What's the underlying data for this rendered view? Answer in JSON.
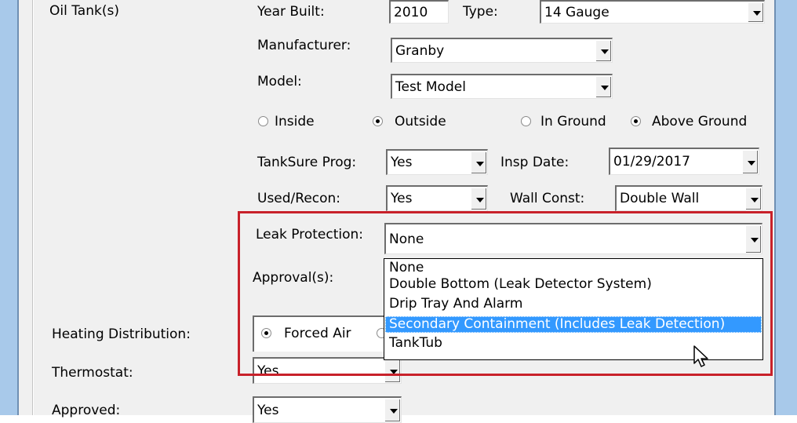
{
  "labels": {
    "oil_tanks": "Oil Tank(s)",
    "year_built": "Year Built:",
    "type": "Type:",
    "manufacturer": "Manufacturer:",
    "model": "Model:",
    "tanksure": "TankSure Prog:",
    "insp_date": "Insp Date:",
    "used_recon": "Used/Recon:",
    "wall_const": "Wall Const:",
    "leak_protection": "Leak Protection:",
    "approvals": "Approval(s):",
    "heating_distribution": "Heating Distribution:",
    "thermostat": "Thermostat:",
    "approved": "Approved:"
  },
  "values": {
    "year_built": "2010",
    "type": "14 Gauge",
    "manufacturer": "Granby",
    "model": "Test Model",
    "tanksure": "Yes",
    "insp_date": "01/29/2017",
    "used_recon": "Yes",
    "wall_const": "Double Wall",
    "leak_protection": "None",
    "thermostat": "Yes",
    "approved": "Yes"
  },
  "radios": {
    "inside": "Inside",
    "outside": "Outside",
    "in_ground": "In Ground",
    "above_ground": "Above Ground",
    "forced_air": "Forced Air"
  },
  "leak_protection_options": [
    "None",
    "Double Bottom (Leak Detector System)",
    "Drip Tray And Alarm",
    "Secondary Containment (Includes Leak Detection)",
    "TankTub"
  ],
  "selected_option_index": 3,
  "colors": {
    "highlight_border": "#c8212a",
    "selection": "#3399ff",
    "window_frame": "#a8c9ea"
  }
}
